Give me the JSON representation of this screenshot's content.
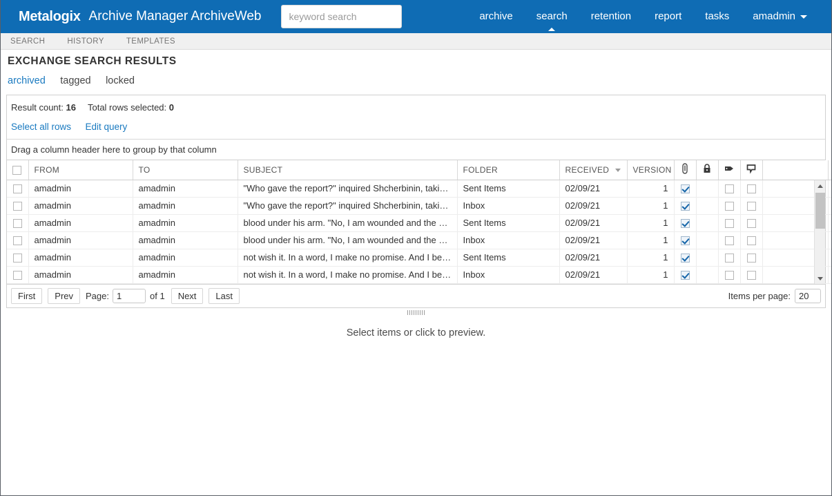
{
  "header": {
    "brand": "Metalogix",
    "app_title": "Archive Manager ArchiveWeb",
    "brand_color": "#0f6cb4",
    "search": {
      "placeholder": "keyword search",
      "value": ""
    },
    "nav": [
      {
        "label": "archive",
        "active": false
      },
      {
        "label": "search",
        "active": true
      },
      {
        "label": "retention",
        "active": false
      },
      {
        "label": "report",
        "active": false
      },
      {
        "label": "tasks",
        "active": false
      }
    ],
    "user": {
      "label": "amadmin",
      "caret": "chevron-down-icon"
    }
  },
  "subnav": {
    "tabs": [
      "SEARCH",
      "HISTORY",
      "TEMPLATES"
    ]
  },
  "page": {
    "title": "EXCHANGE SEARCH RESULTS",
    "filters": [
      {
        "label": "archived",
        "active": true
      },
      {
        "label": "tagged",
        "active": false
      },
      {
        "label": "locked",
        "active": false
      }
    ],
    "accent_link_color": "#1a7ac0"
  },
  "results": {
    "result_count_label": "Result count:",
    "result_count": "16",
    "selected_label": "Total rows selected:",
    "selected_count": "0",
    "links": [
      "Select all rows",
      "Edit query"
    ],
    "group_bar": "Drag a column header here to group by that column"
  },
  "grid": {
    "columns": [
      {
        "key": "check",
        "label": "",
        "type": "checkbox"
      },
      {
        "key": "from",
        "label": "FROM"
      },
      {
        "key": "to",
        "label": "TO"
      },
      {
        "key": "subject",
        "label": "SUBJECT"
      },
      {
        "key": "folder",
        "label": "FOLDER"
      },
      {
        "key": "received",
        "label": "RECEIVED",
        "sorted": true
      },
      {
        "key": "version",
        "label": "VERSION"
      },
      {
        "key": "attachment",
        "label": "",
        "icon": "paperclip-icon"
      },
      {
        "key": "locked",
        "label": "",
        "icon": "lock-icon"
      },
      {
        "key": "tagged",
        "label": "",
        "icon": "tag-icon"
      },
      {
        "key": "comment",
        "label": "",
        "icon": "comment-icon"
      },
      {
        "key": "blank",
        "label": ""
      }
    ],
    "rows": [
      {
        "check": false,
        "from": "amadmin",
        "to": "amadmin",
        "subject": "\"Who gave the report?\" inquired Shcherbinin, taking the ...",
        "folder": "Sent Items",
        "received": "02/09/21",
        "version": "1",
        "attachment": true,
        "locked": false,
        "tagged": false,
        "comment": false
      },
      {
        "check": false,
        "from": "amadmin",
        "to": "amadmin",
        "subject": "\"Who gave the report?\" inquired Shcherbinin, taking the ...",
        "folder": "Inbox",
        "received": "02/09/21",
        "version": "1",
        "attachment": true,
        "locked": false,
        "tagged": false,
        "comment": false
      },
      {
        "check": false,
        "from": "amadmin",
        "to": "amadmin",
        "subject": "blood under his arm. \"No, I am wounded and the horse i...",
        "folder": "Sent Items",
        "received": "02/09/21",
        "version": "1",
        "attachment": true,
        "locked": false,
        "tagged": false,
        "comment": false
      },
      {
        "check": false,
        "from": "amadmin",
        "to": "amadmin",
        "subject": "blood under his arm. \"No, I am wounded and the horse i...",
        "folder": "Inbox",
        "received": "02/09/21",
        "version": "1",
        "attachment": true,
        "locked": false,
        "tagged": false,
        "comment": false
      },
      {
        "check": false,
        "from": "amadmin",
        "to": "amadmin",
        "subject": "not wish it. In a word, I make no promise. And I beg you ...",
        "folder": "Sent Items",
        "received": "02/09/21",
        "version": "1",
        "attachment": true,
        "locked": false,
        "tagged": false,
        "comment": false
      },
      {
        "check": false,
        "from": "amadmin",
        "to": "amadmin",
        "subject": "not wish it. In a word, I make no promise. And I beg you ...",
        "folder": "Inbox",
        "received": "02/09/21",
        "version": "1",
        "attachment": true,
        "locked": false,
        "tagged": false,
        "comment": false
      }
    ]
  },
  "pager": {
    "first": "First",
    "prev": "Prev",
    "page_label": "Page:",
    "page_value": "1",
    "of_label": "of 1",
    "next": "Next",
    "last": "Last",
    "items_per_page_label": "Items per page:",
    "items_per_page_value": "20"
  },
  "preview": {
    "message": "Select items or click to preview."
  }
}
